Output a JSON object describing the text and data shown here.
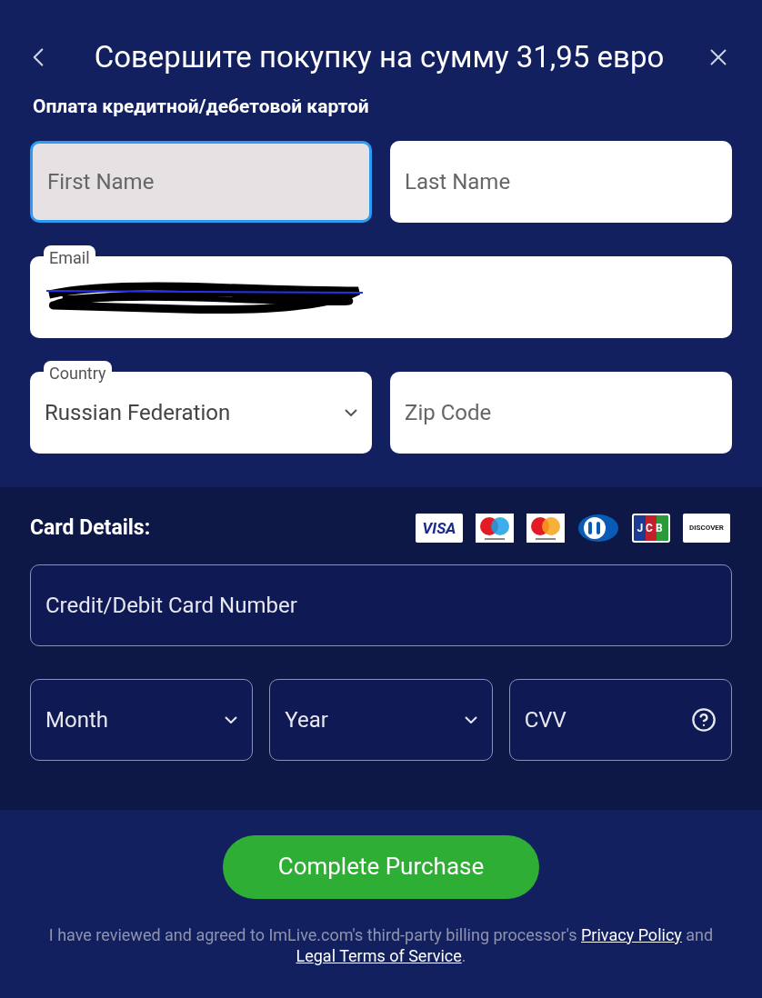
{
  "header": {
    "title": "Совершите покупку на сумму 31,95 евро"
  },
  "subtitle": "Оплата кредитной/дебетовой картой",
  "name_fields": [
    {
      "placeholder": "First Name",
      "focused": true
    },
    {
      "placeholder": "Last Name",
      "focused": false
    }
  ],
  "email": {
    "label": "Email"
  },
  "country": {
    "label": "Country",
    "value": "Russian Federation"
  },
  "zip": {
    "placeholder": "Zip Code"
  },
  "card_details": {
    "title": "Card Details:",
    "brands": [
      {
        "kind": "visa",
        "label": "VISA"
      },
      {
        "kind": "maestro"
      },
      {
        "kind": "mastercard"
      },
      {
        "kind": "diners"
      },
      {
        "kind": "jcb",
        "label": "JCB"
      },
      {
        "kind": "discover",
        "label": "DISCOVER"
      }
    ],
    "card_number": {
      "placeholder": "Credit/Debit Card Number"
    },
    "fields": [
      {
        "kind": "select",
        "placeholder": "Month"
      },
      {
        "kind": "select",
        "placeholder": "Year"
      },
      {
        "kind": "help",
        "placeholder": "CVV"
      }
    ]
  },
  "submit": "Complete Purchase",
  "footer": [
    {
      "kind": "text",
      "text": "I have reviewed and agreed to ImLive.com's third-party billing processor's "
    },
    {
      "kind": "link",
      "text": "Privacy Policy"
    },
    {
      "kind": "text",
      "text": " and "
    },
    {
      "kind": "link",
      "text": "Legal Terms of Service"
    },
    {
      "kind": "text",
      "text": "."
    }
  ]
}
